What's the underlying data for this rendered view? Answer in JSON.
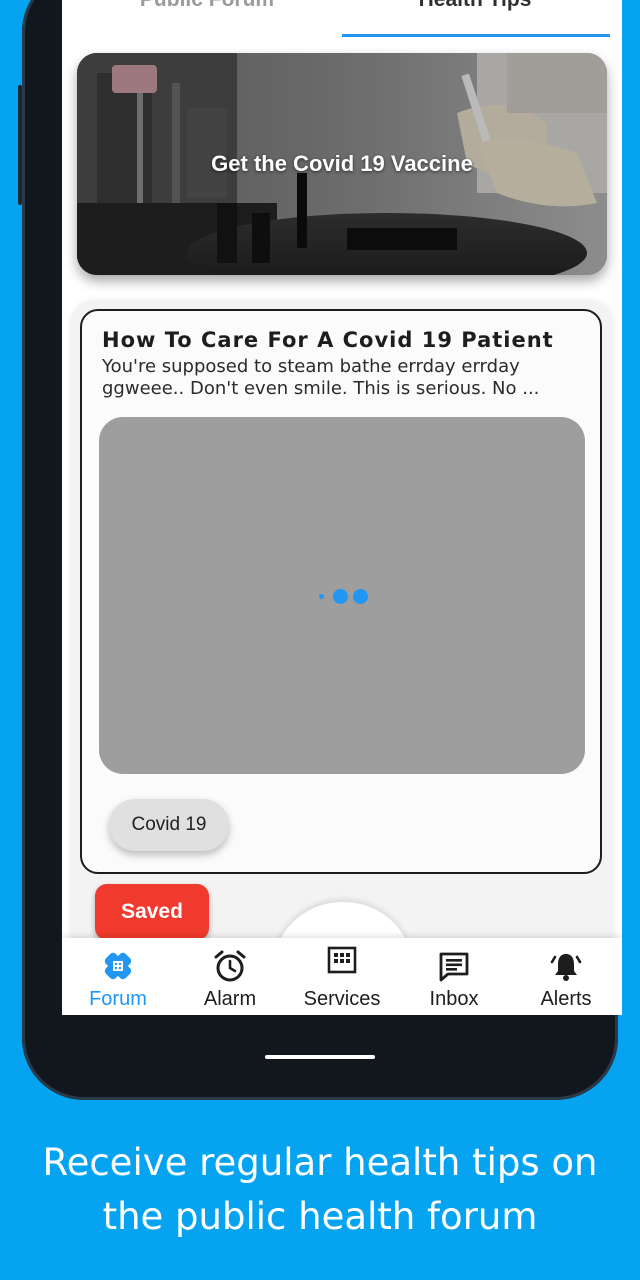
{
  "tabs": {
    "public_forum": "Public Forum",
    "health_tips": "Health Tips"
  },
  "banner": {
    "title": "Get the Covid 19 Vaccine"
  },
  "post": {
    "title": "How To Care For A Covid 19 Patient",
    "body": "You're supposed to steam bathe errday errday ggweee.. Don't even smile. This is serious. No ...",
    "tag": "Covid 19",
    "saved_label": "Saved"
  },
  "bottom_nav": {
    "items": [
      {
        "label": "Forum",
        "icon": "bandage-icon",
        "active": true
      },
      {
        "label": "Alarm",
        "icon": "alarm-clock-icon",
        "active": false
      },
      {
        "label": "Services",
        "icon": "grid-icon",
        "active": false
      },
      {
        "label": "Inbox",
        "icon": "message-icon",
        "active": false
      },
      {
        "label": "Alerts",
        "icon": "bell-icon",
        "active": false
      }
    ]
  },
  "caption": {
    "line1": "Receive regular health tips on",
    "line2": "the public health forum"
  },
  "colors": {
    "background": "#06a4f0",
    "accent": "#2196f3",
    "saved_button": "#f13a2e"
  }
}
